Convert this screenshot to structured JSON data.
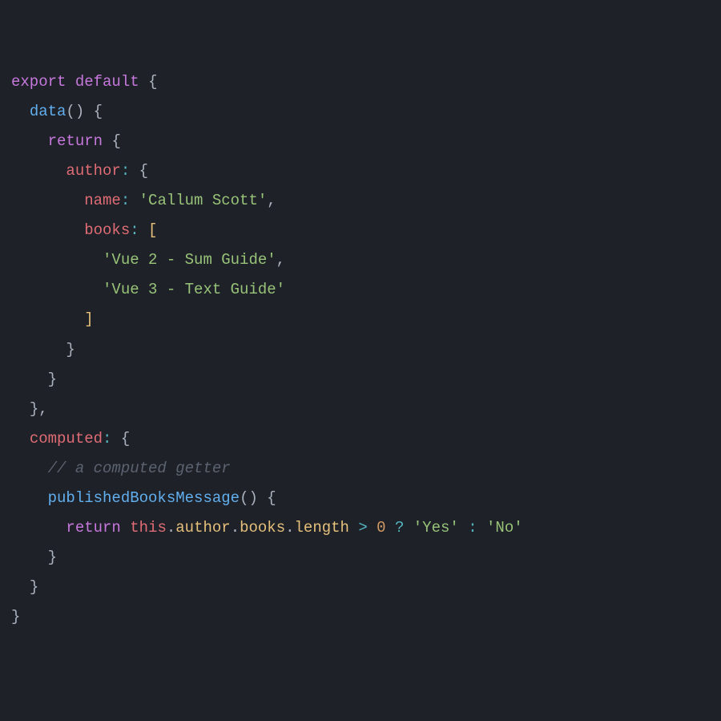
{
  "code": {
    "line1": {
      "export": "export",
      "default": "default",
      "brace": "{"
    },
    "line2": {
      "method": "data",
      "parens": "()",
      "brace": "{"
    },
    "line3": {
      "return": "return",
      "brace": "{"
    },
    "line4": {
      "prop": "author",
      "colon": ":",
      "brace": "{"
    },
    "line5": {
      "prop": "name",
      "colon": ":",
      "string": "'Callum Scott'",
      "comma": ","
    },
    "line6": {
      "prop": "books",
      "colon": ":",
      "bracket": "["
    },
    "line7": {
      "string": "'Vue 2 - Sum Guide'",
      "comma": ","
    },
    "line8": {
      "string": "'Vue 3 - Text Guide'"
    },
    "line9": {
      "bracket": "]"
    },
    "line10": {
      "brace": "}"
    },
    "line11": {
      "brace": "}"
    },
    "line12": {
      "brace": "}",
      "comma": ","
    },
    "line13": {
      "prop": "computed",
      "colon": ":",
      "brace": "{"
    },
    "line14": {
      "comment": "// a computed getter"
    },
    "line15": {
      "method": "publishedBooksMessage",
      "parens": "()",
      "brace": "{"
    },
    "line16": {
      "return": "return",
      "this": "this",
      "dot1": ".",
      "author": "author",
      "dot2": ".",
      "books": "books",
      "dot3": ".",
      "length": "length",
      "gt": ">",
      "zero": "0",
      "q": "?",
      "yes": "'Yes'",
      "colon": ":",
      "no": "'No'"
    },
    "line17": {
      "brace": "}"
    },
    "line18": {
      "brace": "}"
    },
    "line19": {
      "brace": "}"
    }
  }
}
